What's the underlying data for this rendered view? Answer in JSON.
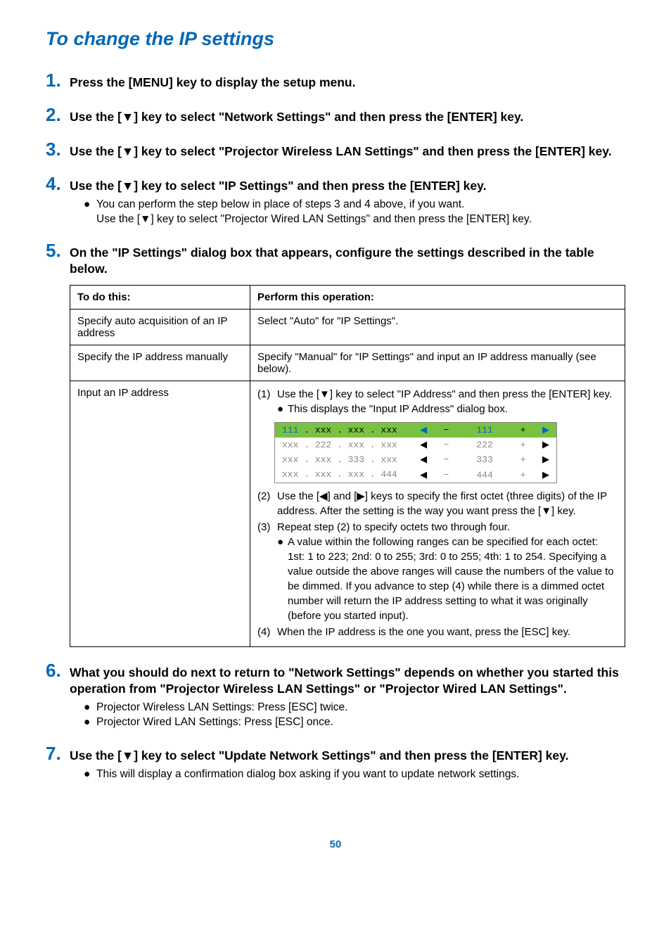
{
  "title": "To change the IP settings",
  "steps": {
    "s1": {
      "num": "1.",
      "text": "Press the [MENU] key to display the setup menu."
    },
    "s2": {
      "num": "2.",
      "text": "Use the [▼] key to select \"Network Settings\" and then press the [ENTER] key."
    },
    "s3": {
      "num": "3.",
      "text": "Use the [▼] key to select \"Projector Wireless LAN Settings\" and then press the [ENTER] key."
    },
    "s4": {
      "num": "4.",
      "text": "Use the [▼] key to select \"IP Settings\" and then press the [ENTER] key.",
      "bullet": "You can perform the step below in place of steps 3 and 4 above, if you want.",
      "subline": "Use the [▼] key to select \"Projector Wired LAN Settings\" and then press the [ENTER] key."
    },
    "s5": {
      "num": "5.",
      "text": "On the \"IP Settings\" dialog box that appears, configure the settings described in the table below."
    },
    "s6": {
      "num": "6.",
      "text": "What you should do next to return to \"Network Settings\" depends on whether you started this operation from \"Projector Wireless LAN Settings\" or \"Projector Wired LAN Settings\".",
      "bullet1": "Projector Wireless LAN Settings: Press [ESC] twice.",
      "bullet2": "Projector Wired LAN Settings: Press [ESC] once."
    },
    "s7": {
      "num": "7.",
      "text": "Use the [▼] key to select \"Update Network Settings\" and then press the [ENTER] key.",
      "bullet": "This will display a confirmation dialog box asking if you want to update network settings."
    }
  },
  "table": {
    "header": {
      "c1": "To do this:",
      "c2": "Perform this operation:"
    },
    "r1": {
      "c1": "Specify auto acquisition of an IP address",
      "c2": "Select \"Auto\" for \"IP Settings\"."
    },
    "r2": {
      "c1": "Specify the IP address manually",
      "c2": "Specify \"Manual\" for \"IP Settings\" and input an IP address manually (see below)."
    },
    "r3": {
      "c1": "Input an IP address",
      "n1": {
        "marker": "(1)",
        "text": "Use the [▼] key to select \"IP Address\" and then press the [ENTER] key.",
        "bullet": "This displays the \"Input IP Address\" dialog box."
      },
      "ip": {
        "row1": {
          "left_a": "111",
          "left_rest": " . xxx . xxx . xxx",
          "arrow_l": "◀",
          "minus": "−",
          "val": "111",
          "plus": "+",
          "arrow_r": "▶"
        },
        "row2": {
          "left_pre": "xxx . ",
          "left_a": "222",
          "left_rest": " . xxx . xxx",
          "arrow_l": "◀",
          "minus": "−",
          "val": "222",
          "plus": "+",
          "arrow_r": "▶"
        },
        "row3": {
          "left_pre": "xxx . xxx . ",
          "left_a": "333",
          "left_rest": " . xxx",
          "arrow_l": "◀",
          "minus": "−",
          "val": "333",
          "plus": "+",
          "arrow_r": "▶"
        },
        "row4": {
          "left_pre": "xxx . xxx . xxx . ",
          "left_a": "444",
          "left_rest": "",
          "arrow_l": "◀",
          "minus": "−",
          "val": "444",
          "plus": "+",
          "arrow_r": "▶"
        }
      },
      "n2": {
        "marker": "(2)",
        "text": "Use the [◀] and [▶] keys to specify the first octet (three digits) of the IP address. After the setting is the way you want press the [▼] key."
      },
      "n3": {
        "marker": "(3)",
        "text": "Repeat step (2) to specify octets two through four.",
        "bullet": "A value within the following ranges can be specified for each octet: 1st: 1 to 223; 2nd: 0 to 255; 3rd: 0 to 255; 4th: 1 to 254. Specifying a value outside the above ranges will cause the numbers of the value to be dimmed. If you advance to step (4) while there is a dimmed octet number will return the IP address setting to what it was originally (before you started input)."
      },
      "n4": {
        "marker": "(4)",
        "text": "When the IP address is the one you want, press the [ESC] key."
      }
    }
  },
  "page_number": "50"
}
